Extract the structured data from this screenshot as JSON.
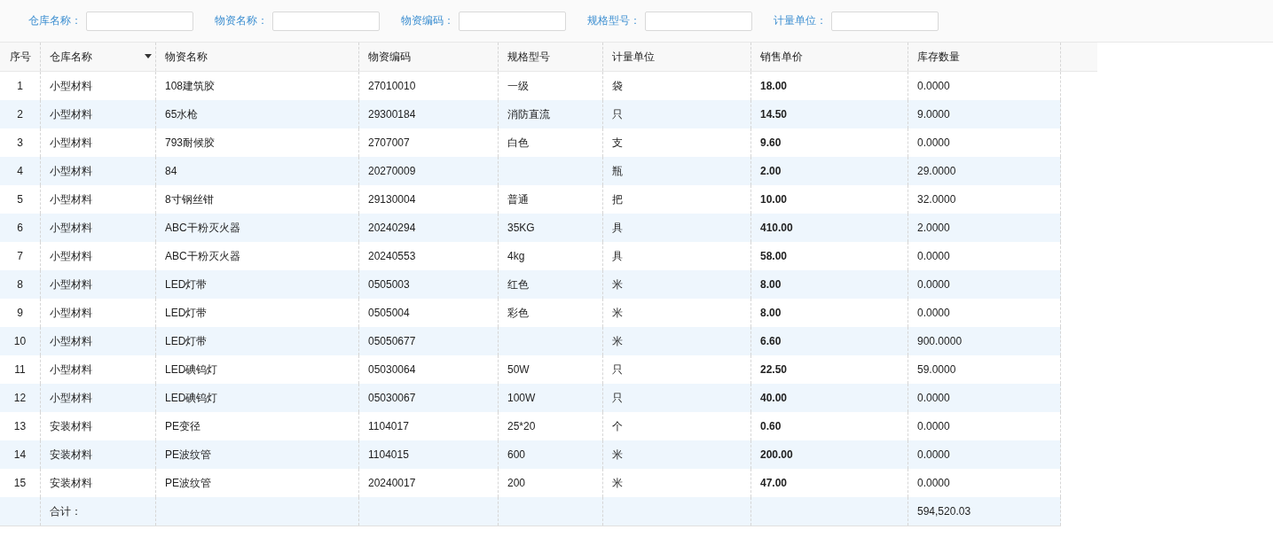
{
  "filters": [
    {
      "label": "仓库名称："
    },
    {
      "label": "物资名称："
    },
    {
      "label": "物资编码："
    },
    {
      "label": "规格型号："
    },
    {
      "label": "计量单位："
    }
  ],
  "table": {
    "columns": [
      {
        "label": "序号",
        "menu": false,
        "kind": "index"
      },
      {
        "label": "仓库名称",
        "menu": true,
        "kind": "text"
      },
      {
        "label": "物资名称",
        "menu": false,
        "kind": "text"
      },
      {
        "label": "物资编码",
        "menu": false,
        "kind": "text"
      },
      {
        "label": "规格型号",
        "menu": false,
        "kind": "text"
      },
      {
        "label": "计量单位",
        "menu": false,
        "kind": "text"
      },
      {
        "label": "销售单价",
        "menu": false,
        "kind": "price"
      },
      {
        "label": "库存数量",
        "menu": false,
        "kind": "text"
      }
    ],
    "rows": [
      [
        "1",
        "小型材料",
        "108建筑胶",
        "27010010",
        "一级",
        "袋",
        "18.00",
        "0.0000"
      ],
      [
        "2",
        "小型材料",
        "65水枪",
        "29300184",
        "消防直流",
        "只",
        "14.50",
        "9.0000"
      ],
      [
        "3",
        "小型材料",
        "793耐候胶",
        "2707007",
        "白色",
        "支",
        "9.60",
        "0.0000"
      ],
      [
        "4",
        "小型材料",
        "84",
        "20270009",
        null,
        "瓶",
        "2.00",
        "29.0000"
      ],
      [
        "5",
        "小型材料",
        "8寸钢丝钳",
        "29130004",
        "普通",
        "把",
        "10.00",
        "32.0000"
      ],
      [
        "6",
        "小型材料",
        "ABC干粉灭火器",
        "20240294",
        "35KG",
        "具",
        "410.00",
        "2.0000"
      ],
      [
        "7",
        "小型材料",
        "ABC干粉灭火器",
        "20240553",
        "4kg",
        "具",
        "58.00",
        "0.0000"
      ],
      [
        "8",
        "小型材料",
        "LED灯带",
        "0505003",
        "红色",
        "米",
        "8.00",
        "0.0000"
      ],
      [
        "9",
        "小型材料",
        "LED灯带",
        "0505004",
        "彩色",
        "米",
        "8.00",
        "0.0000"
      ],
      [
        "10",
        "小型材料",
        "LED灯带",
        "05050677",
        null,
        "米",
        "6.60",
        "900.0000"
      ],
      [
        "11",
        "小型材料",
        "LED碘钨灯",
        "05030064",
        "50W",
        "只",
        "22.50",
        "59.0000"
      ],
      [
        "12",
        "小型材料",
        "LED碘钨灯",
        "05030067",
        "100W",
        "只",
        "40.00",
        "0.0000"
      ],
      [
        "13",
        "安装材料",
        "PE变径",
        "1104017",
        "25*20",
        "个",
        "0.60",
        "0.0000"
      ],
      [
        "14",
        "安装材料",
        "PE波纹管",
        "1104015",
        "600",
        "米",
        "200.00",
        "0.0000"
      ],
      [
        "15",
        "安装材料",
        "PE波纹管",
        "20240017",
        "200",
        "米",
        "47.00",
        "0.0000"
      ]
    ],
    "footer": {
      "label": "合计：",
      "total": "594,520.03"
    }
  }
}
